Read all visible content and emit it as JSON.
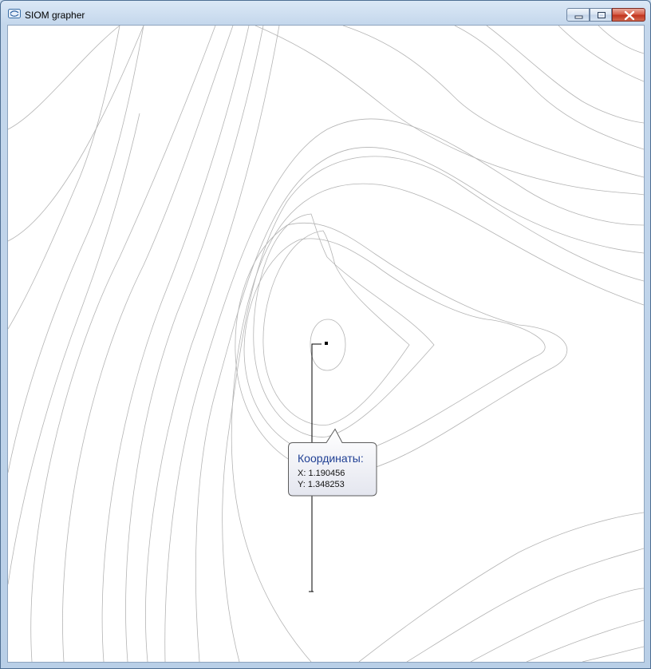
{
  "window": {
    "title": "SIOM grapher",
    "app_icon": "siom-app-icon",
    "controls": [
      "minimize-icon",
      "maximize-icon",
      "close-icon"
    ],
    "accent_close": "#c1351f"
  },
  "plot": {
    "line_color": "#b4b4b4",
    "path_color": "#000000",
    "background": "#ffffff"
  },
  "tooltip": {
    "title": "Координаты:",
    "x_text": "X: 1.190456",
    "y_text": "Y: 1.348253",
    "title_color": "#1f3f94"
  }
}
